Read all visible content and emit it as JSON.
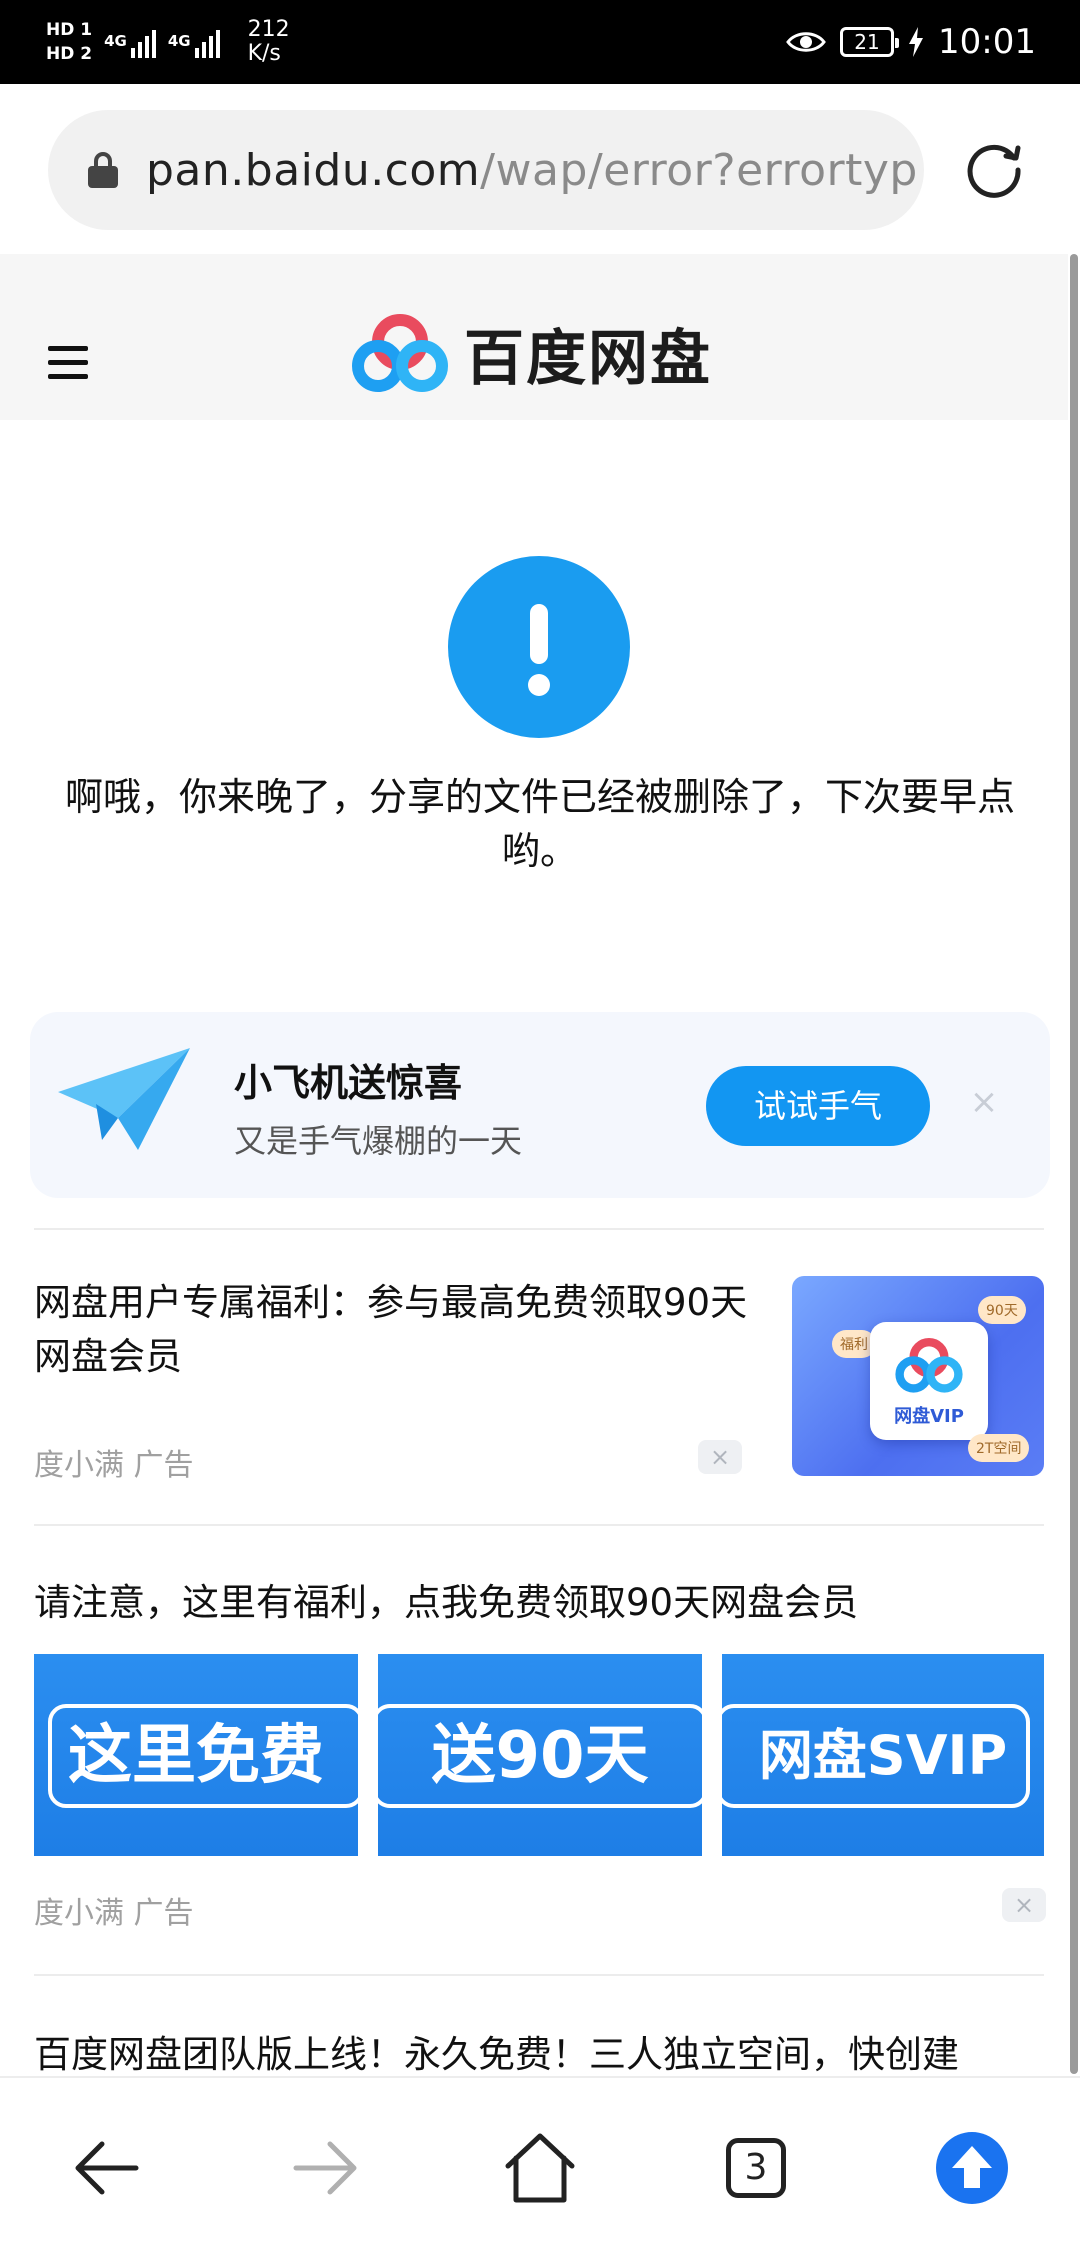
{
  "status_bar": {
    "sim1": "HD 1",
    "sim2": "HD 2",
    "net1": "4G",
    "net2": "4G",
    "speed_value": "212",
    "speed_unit": "K/s",
    "battery": "21",
    "time": "10:01"
  },
  "url_bar": {
    "host": "pan.baidu.com",
    "path": "/wap/error?errortyp"
  },
  "header": {
    "logo_text": "百度网盘"
  },
  "error": {
    "message": "啊哦，你来晚了，分享的文件已经被删除了，下次要早点哟。"
  },
  "promo": {
    "title": "小飞机送惊喜",
    "subtitle": "又是手气爆棚的一天",
    "button": "试试手气",
    "close": "×"
  },
  "ads": [
    {
      "title": "网盘用户专属福利：参与最高免费领取90天网盘会员",
      "source": "度小满 广告",
      "close": "×",
      "image_label": "网盘VIP",
      "badge_top": "90天",
      "badge_left": "福利",
      "badge_bottom": "2T空间"
    },
    {
      "title": "请注意，这里有福利，点我免费领取90天网盘会员",
      "source": "度小满 广告",
      "close": "×",
      "banners": [
        "这里免费",
        "送90天",
        "网盘SVIP"
      ]
    },
    {
      "title": "百度网盘团队版上线！永久免费！三人独立空间，快创建"
    }
  ],
  "bottom_nav": {
    "tab_count": "3"
  },
  "colors": {
    "accent": "#1296f2",
    "error_icon": "#1a9cf0"
  }
}
